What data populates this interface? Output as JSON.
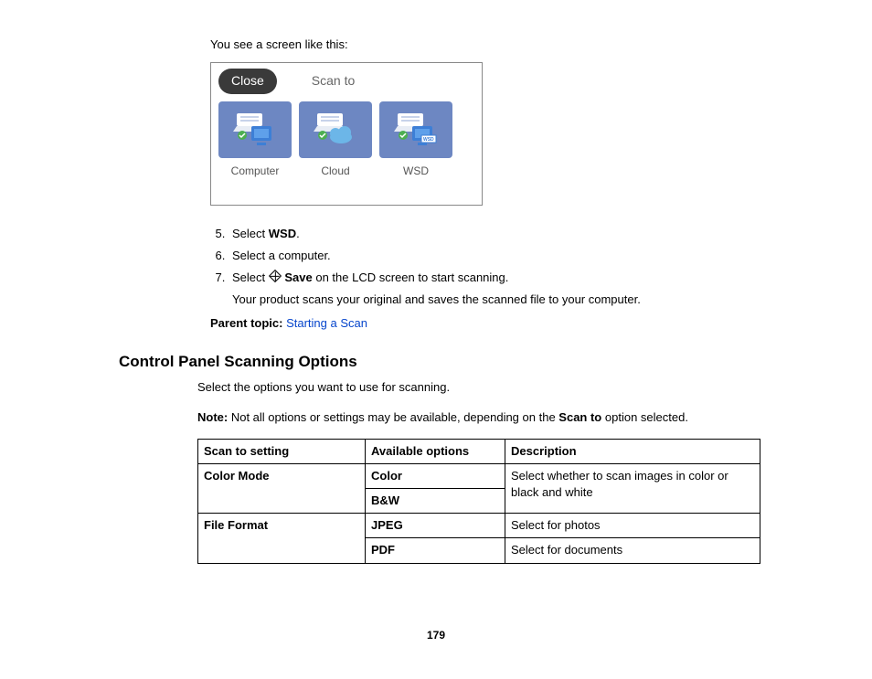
{
  "intro": "You see a screen like this:",
  "lcd": {
    "close": "Close",
    "title": "Scan to",
    "tiles": [
      "Computer",
      "Cloud",
      "WSD"
    ]
  },
  "steps": {
    "s5_prefix": "Select ",
    "s5_bold": "WSD",
    "s5_suffix": ".",
    "s6": "Select a computer.",
    "s7_prefix": "Select ",
    "s7_bold": "Save",
    "s7_suffix": " on the LCD screen to start scanning.",
    "s7_sub": "Your product scans your original and saves the scanned file to your computer."
  },
  "parent_topic_label": "Parent topic:",
  "parent_topic_link": "Starting a Scan",
  "heading": "Control Panel Scanning Options",
  "section_intro": "Select the options you want to use for scanning.",
  "note_label": "Note:",
  "note_text_a": " Not all options or settings may be available, depending on the ",
  "note_bold": "Scan to",
  "note_text_b": " option selected.",
  "table": {
    "h1": "Scan to setting",
    "h2": "Available options",
    "h3": "Description",
    "r1_setting": "Color Mode",
    "r1_opt1": "Color",
    "r1_opt2": "B&W",
    "r1_desc": "Select whether to scan images in color or black and white",
    "r2_setting": "File Format",
    "r2_opt1": "JPEG",
    "r2_opt2": "PDF",
    "r2_desc1": "Select for photos",
    "r2_desc2": "Select for documents"
  },
  "page_number": "179"
}
